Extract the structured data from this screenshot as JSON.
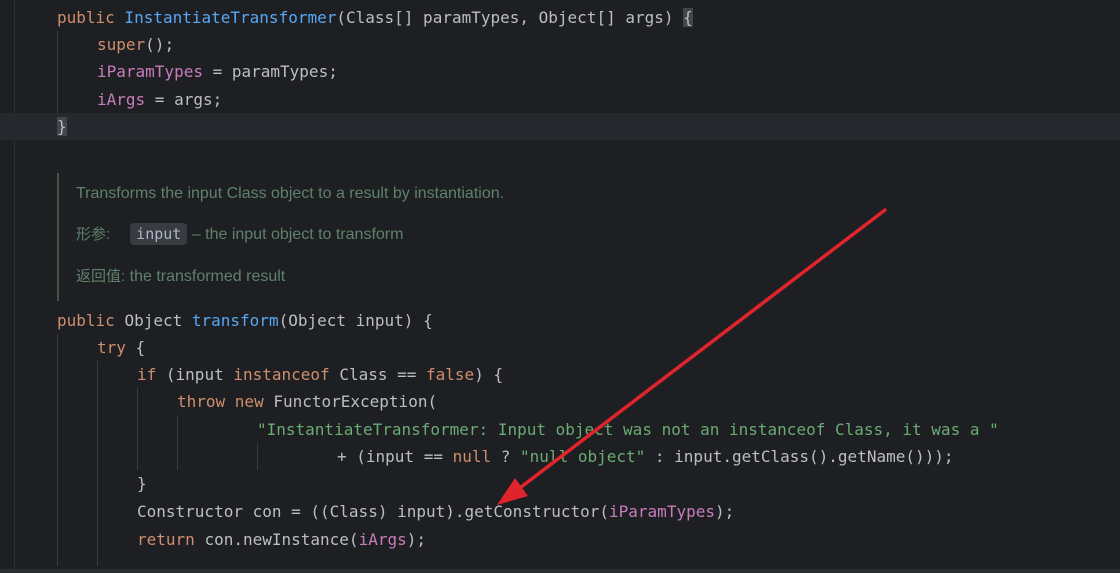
{
  "editor": {
    "lines": [
      {
        "id": "l1",
        "tokens": [
          [
            "kw",
            "public "
          ],
          [
            "fn",
            "InstantiateTransformer"
          ],
          [
            "plain",
            "(Class[] paramTypes, Object[] args) "
          ],
          [
            "brace",
            "{"
          ]
        ]
      },
      {
        "id": "l2",
        "tokens": [
          [
            "kw",
            "super"
          ],
          [
            "plain",
            "();"
          ]
        ]
      },
      {
        "id": "l3",
        "tokens": [
          [
            "field",
            "iParamTypes"
          ],
          [
            "plain",
            " = paramTypes;"
          ]
        ]
      },
      {
        "id": "l4",
        "tokens": [
          [
            "field",
            "iArgs"
          ],
          [
            "plain",
            " = args;"
          ]
        ]
      },
      {
        "id": "l5",
        "tokens": [
          [
            "brace",
            "}"
          ]
        ]
      },
      {
        "id": "l6",
        "tokens": [
          [
            "kw",
            "public "
          ],
          [
            "plain",
            "Object "
          ],
          [
            "fn",
            "transform"
          ],
          [
            "plain",
            "(Object input) {"
          ]
        ]
      },
      {
        "id": "l7",
        "tokens": [
          [
            "kw",
            "try "
          ],
          [
            "plain",
            "{"
          ]
        ]
      },
      {
        "id": "l8",
        "tokens": [
          [
            "kw",
            "if "
          ],
          [
            "plain",
            "(input "
          ],
          [
            "kw",
            "instanceof "
          ],
          [
            "plain",
            "Class == "
          ],
          [
            "kw",
            "false"
          ],
          [
            "plain",
            ") {"
          ]
        ]
      },
      {
        "id": "l9",
        "tokens": [
          [
            "kw",
            "throw new "
          ],
          [
            "plain",
            "FunctorException("
          ]
        ]
      },
      {
        "id": "l10",
        "tokens": [
          [
            "str",
            "\"InstantiateTransformer: Input object was not an instanceof Class, it was a \""
          ]
        ]
      },
      {
        "id": "l11",
        "tokens": [
          [
            "plain",
            "+ (input == "
          ],
          [
            "kw",
            "null "
          ],
          [
            "plain",
            "? "
          ],
          [
            "str",
            "\"null object\""
          ],
          [
            "plain",
            " : input.getClass().getName()));"
          ]
        ]
      },
      {
        "id": "l12",
        "tokens": [
          [
            "plain",
            "}"
          ]
        ]
      },
      {
        "id": "l13",
        "tokens": [
          [
            "plain",
            "Constructor con = ((Class) input).getConstructor("
          ],
          [
            "field",
            "iParamTypes"
          ],
          [
            "plain",
            ");"
          ]
        ]
      },
      {
        "id": "l14",
        "tokens": [
          [
            "kw",
            "return "
          ],
          [
            "plain",
            "con.newInstance("
          ],
          [
            "field",
            "iArgs"
          ],
          [
            "plain",
            ");"
          ]
        ]
      }
    ],
    "doc": {
      "summary": "Transforms the input Class object to a result by instantiation.",
      "param_label": "形参:",
      "param_name": "input",
      "param_desc": "– the input object to transform",
      "return_label": "返回值:",
      "return_desc": "the transformed result"
    }
  }
}
